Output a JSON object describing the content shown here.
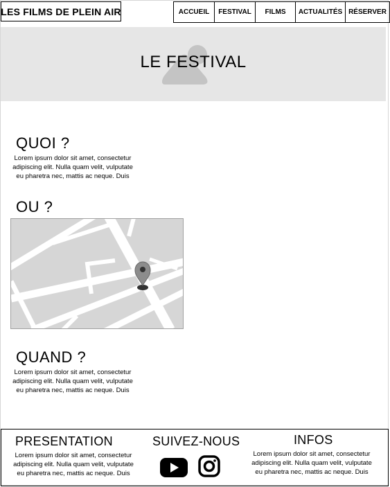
{
  "header": {
    "logo": "LES FILMS DE PLEIN AIR",
    "nav": [
      "ACCUEIL",
      "FESTIVAL",
      "FILMS",
      "ACTUALITÉS",
      "RÉSERVER"
    ]
  },
  "hero": {
    "title": "LE FESTIVAL",
    "icon": "image-placeholder-icon"
  },
  "sections": {
    "quoi": {
      "title": "QUOI ?",
      "text": [
        "Lorem ipsum dolor sit amet, consectetur",
        "adipiscing elit. Nulla quam velit, vulputate",
        "eu pharetra nec, mattis ac neque. Duis"
      ]
    },
    "ou": {
      "title": "OU ?",
      "map_icon": "map-pin-icon"
    },
    "quand": {
      "title": "QUAND ?",
      "text": [
        "Lorem ipsum dolor sit amet, consectetur",
        "adipiscing elit. Nulla quam velit, vulputate",
        "eu pharetra nec, mattis ac neque. Duis"
      ]
    }
  },
  "footer": {
    "presentation": {
      "title": "PRESENTATION",
      "text": [
        "Lorem ipsum dolor sit amet, consectetur",
        "adipiscing elit. Nulla quam velit, vulputate",
        "eu pharetra nec, mattis ac neque. Duis"
      ]
    },
    "social": {
      "title": "SUIVEZ-NOUS",
      "icons": [
        "youtube-icon",
        "instagram-icon"
      ]
    },
    "infos": {
      "title": "INFOS",
      "text": [
        "Lorem ipsum dolor sit amet, consectetur",
        "adipiscing elit. Nulla quam velit, vulputate",
        "eu pharetra nec, mattis ac neque. Duis"
      ]
    }
  },
  "colors": {
    "hero_bg": "#e6e6e6",
    "map_bg": "#d6d6d6",
    "text": "#000000"
  }
}
